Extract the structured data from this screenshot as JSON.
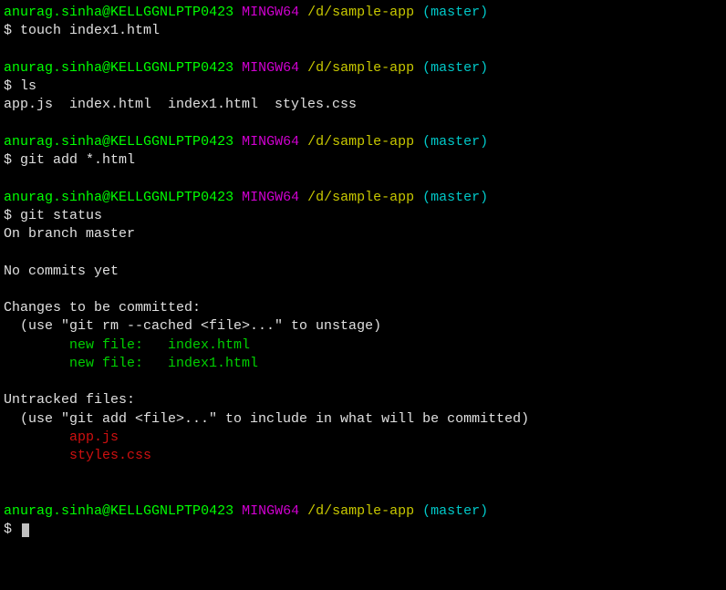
{
  "prompt": {
    "user": "anurag.sinha",
    "at": "@",
    "host": "KELLGGNLPTP0423",
    "env": "MINGW64",
    "path": "/d/sample-app",
    "branch": "(master)",
    "dollar": "$"
  },
  "blocks": [
    {
      "cmd": "touch index1.html",
      "output": []
    },
    {
      "cmd": "ls",
      "output": [
        {
          "type": "plain",
          "text": "app.js  index.html  index1.html  styles.css"
        }
      ]
    },
    {
      "cmd": "git add *.html",
      "output": []
    },
    {
      "cmd": "git status",
      "output": [
        {
          "type": "plain",
          "text": "On branch master"
        },
        {
          "type": "blank"
        },
        {
          "type": "plain",
          "text": "No commits yet"
        },
        {
          "type": "blank"
        },
        {
          "type": "plain",
          "text": "Changes to be committed:"
        },
        {
          "type": "plain",
          "text": "  (use \"git rm --cached <file>...\" to unstage)"
        },
        {
          "type": "staged",
          "prefix": "        new file:   ",
          "file": "index.html"
        },
        {
          "type": "staged",
          "prefix": "        new file:   ",
          "file": "index1.html"
        },
        {
          "type": "blank"
        },
        {
          "type": "plain",
          "text": "Untracked files:"
        },
        {
          "type": "plain",
          "text": "  (use \"git add <file>...\" to include in what will be committed)"
        },
        {
          "type": "untracked",
          "prefix": "        ",
          "file": "app.js"
        },
        {
          "type": "untracked",
          "prefix": "        ",
          "file": "styles.css"
        },
        {
          "type": "blank"
        }
      ]
    }
  ],
  "final": {
    "cmd": ""
  }
}
